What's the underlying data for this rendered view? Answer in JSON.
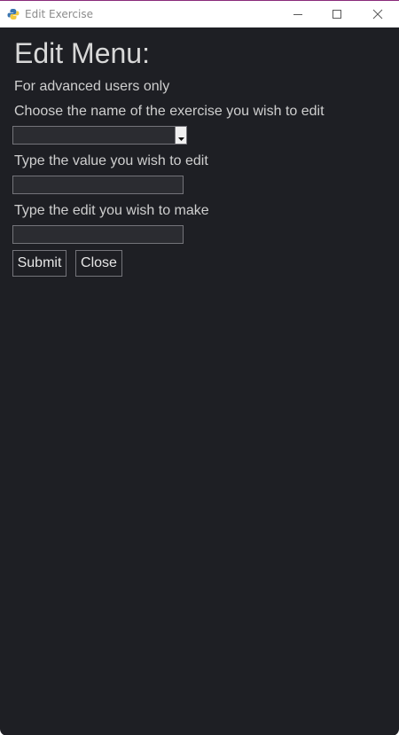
{
  "window": {
    "title": "Edit Exercise",
    "icon": "python-icon",
    "controls": [
      "minimize-icon",
      "maximize-icon",
      "close-icon"
    ]
  },
  "form": {
    "heading": "Edit Menu:",
    "advanced_note": "For advanced users only",
    "choose_label": "Choose the name of the exercise you wish to edit",
    "exercise_select": {
      "selected": ""
    },
    "value_label": "Type the value you wish to edit",
    "value_input": {
      "value": "",
      "placeholder": ""
    },
    "edit_label": "Type the edit you wish to make",
    "edit_input": {
      "value": "",
      "placeholder": ""
    },
    "submit_label": "Submit",
    "close_label": "Close"
  },
  "colors": {
    "background": "#1e1f24",
    "text": "#cfcfcf",
    "field_border": "#74747a"
  }
}
